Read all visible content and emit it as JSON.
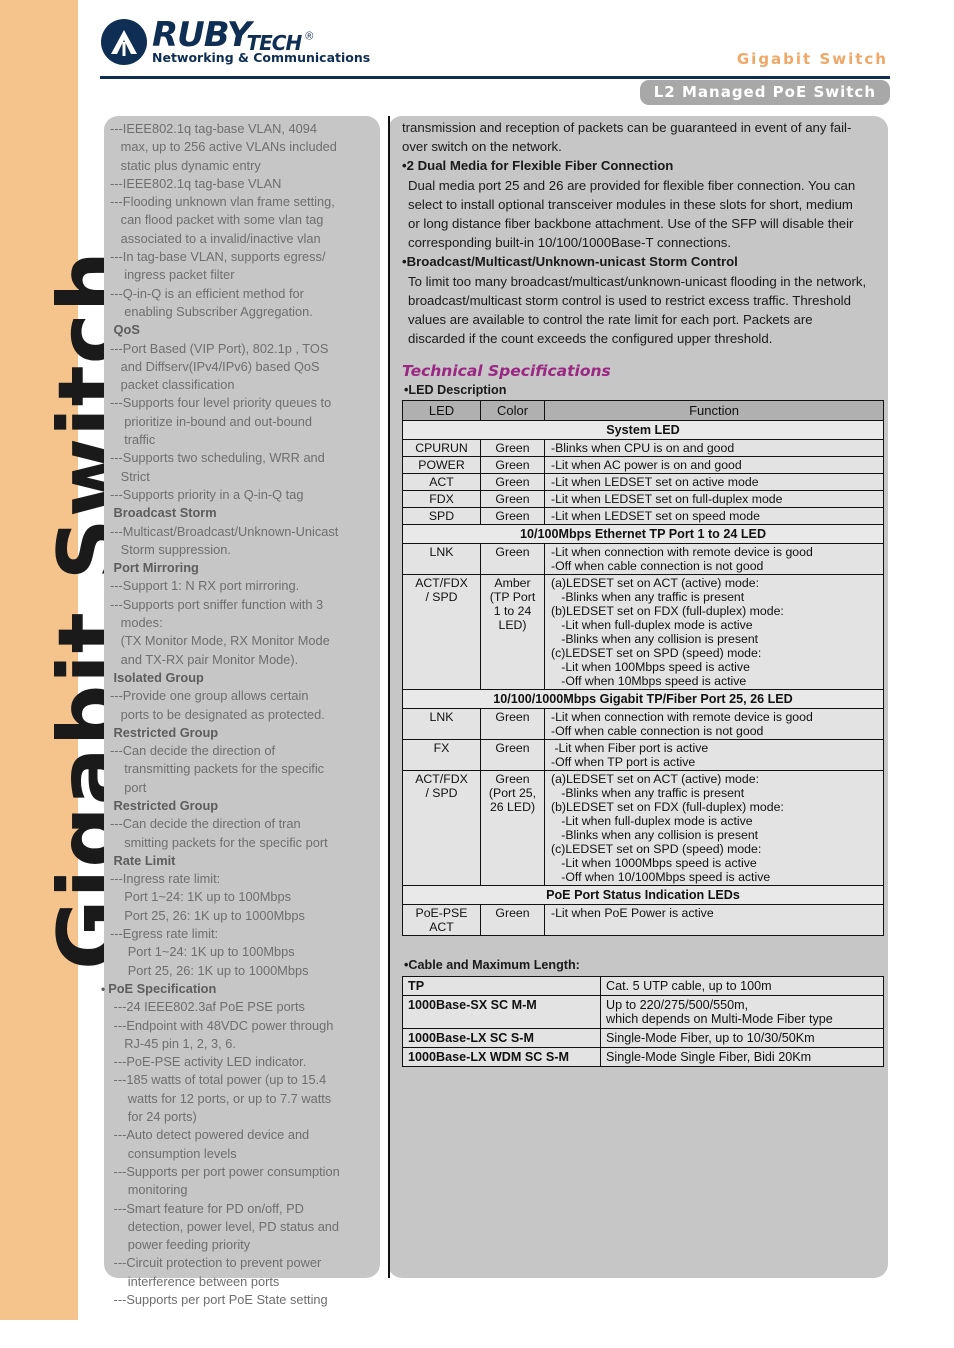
{
  "sidebar": {
    "vertical_text": "Gigabit Switch"
  },
  "header": {
    "logo_main": "RUBY",
    "logo_tech": "TECH",
    "logo_reg": "®",
    "logo_sub": "Networking & Communications",
    "product_line": "Gigabit Switch",
    "product_badge": "L2 Managed PoE Switch",
    "accent_orange": "#f0a868",
    "accent_navy": "#0e2e53",
    "accent_purple": "#9b2683",
    "badge_gray": "#a8a8a8"
  },
  "left_column": {
    "lines": [
      {
        "type": "item",
        "text": "---IEEE802.1q tag-base VLAN, 4094"
      },
      {
        "type": "cont",
        "text": "   max, up to 256 active VLANs included"
      },
      {
        "type": "cont",
        "text": "   static plus dynamic entry"
      },
      {
        "type": "item",
        "text": "---IEEE802.1q tag-base VLAN"
      },
      {
        "type": "item",
        "text": "---Flooding unknown vlan frame setting,"
      },
      {
        "type": "cont",
        "text": "   can flood packet with some vlan tag"
      },
      {
        "type": "cont",
        "text": "   associated to a invalid/inactive vlan"
      },
      {
        "type": "item",
        "text": "---In tag-base VLAN, supports egress/"
      },
      {
        "type": "cont",
        "text": "    ingress packet filter"
      },
      {
        "type": "item",
        "text": "---Q-in-Q is an efficient method for"
      },
      {
        "type": "cont",
        "text": "    enabling Subscriber Aggregation."
      },
      {
        "type": "head",
        "text": " QoS"
      },
      {
        "type": "item",
        "text": "---Port Based (VIP Port), 802.1p , TOS"
      },
      {
        "type": "cont",
        "text": "   and Diffserv(IPv4/IPv6) based QoS"
      },
      {
        "type": "cont",
        "text": "   packet classification"
      },
      {
        "type": "item",
        "text": "---Supports four level priority queues to"
      },
      {
        "type": "cont",
        "text": "    prioritize in-bound and out-bound"
      },
      {
        "type": "cont",
        "text": "    traffic"
      },
      {
        "type": "item",
        "text": "---Supports two scheduling, WRR and"
      },
      {
        "type": "cont",
        "text": "   Strict"
      },
      {
        "type": "item",
        "text": "---Supports priority in a Q-in-Q tag"
      },
      {
        "type": "head",
        "text": " Broadcast Storm"
      },
      {
        "type": "item",
        "text": "---Multicast/Broadcast/Unknown-Unicast"
      },
      {
        "type": "cont",
        "text": "   Storm suppression."
      },
      {
        "type": "head",
        "text": " Port Mirroring"
      },
      {
        "type": "item",
        "text": "---Support 1: N RX port mirroring."
      },
      {
        "type": "item",
        "text": "---Supports port sniffer function with 3"
      },
      {
        "type": "cont",
        "text": "   modes:"
      },
      {
        "type": "cont",
        "text": "   (TX Monitor Mode, RX Monitor Mode"
      },
      {
        "type": "cont",
        "text": "   and TX-RX pair Monitor Mode)."
      },
      {
        "type": "head",
        "text": " Isolated Group"
      },
      {
        "type": "item",
        "text": "---Provide one group allows certain"
      },
      {
        "type": "cont",
        "text": "   ports to be designated as protected."
      },
      {
        "type": "head",
        "text": " Restricted Group"
      },
      {
        "type": "item",
        "text": "---Can decide the direction of"
      },
      {
        "type": "cont",
        "text": "    transmitting packets for the specific"
      },
      {
        "type": "cont",
        "text": "    port"
      },
      {
        "type": "head",
        "text": " Restricted Group"
      },
      {
        "type": "item",
        "text": "---Can decide the direction of tran"
      },
      {
        "type": "cont",
        "text": "    smitting packets for the specific port"
      },
      {
        "type": "head",
        "text": " Rate Limit"
      },
      {
        "type": "item",
        "text": "---Ingress rate limit:"
      },
      {
        "type": "cont",
        "text": "    Port 1~24: 1K up to 100Mbps"
      },
      {
        "type": "cont",
        "text": "    Port 25, 26: 1K up to 1000Mbps"
      },
      {
        "type": "item",
        "text": "---Egress rate limit:"
      },
      {
        "type": "cont",
        "text": "     Port 1~24: 1K up to 100Mbps"
      },
      {
        "type": "cont",
        "text": "     Port 25, 26: 1K up to 1000Mbps"
      },
      {
        "type": "bullet",
        "text": "PoE Specification"
      },
      {
        "type": "item",
        "text": " ---24 IEEE802.3af PoE PSE ports"
      },
      {
        "type": "item",
        "text": " ---Endpoint with 48VDC power through"
      },
      {
        "type": "cont",
        "text": "    RJ-45 pin 1, 2, 3, 6."
      },
      {
        "type": "item",
        "text": " ---PoE-PSE activity LED indicator."
      },
      {
        "type": "item",
        "text": " ---185 watts of total power (up to 15.4"
      },
      {
        "type": "cont",
        "text": "     watts for 12 ports, or up to 7.7 watts"
      },
      {
        "type": "cont",
        "text": "     for 24 ports)"
      },
      {
        "type": "item",
        "text": " ---Auto detect powered device and"
      },
      {
        "type": "cont",
        "text": "     consumption levels"
      },
      {
        "type": "item",
        "text": " ---Supports per port power consumption"
      },
      {
        "type": "cont",
        "text": "     monitoring"
      },
      {
        "type": "item",
        "text": " ---Smart feature for PD on/off, PD"
      },
      {
        "type": "cont",
        "text": "     detection, power level, PD status and"
      },
      {
        "type": "cont",
        "text": "     power feeding priority"
      },
      {
        "type": "item",
        "text": " ---Circuit protection to prevent power"
      },
      {
        "type": "cont",
        "text": "     interference between ports"
      },
      {
        "type": "item",
        "text": " ---Supports per port PoE State setting"
      }
    ]
  },
  "right_column": {
    "intro_lines": [
      "transmission and reception of packets can be guaranteed in event of any fail-",
      "over switch on the network."
    ],
    "sections": [
      {
        "heading": "2 Dual Media for Flexible Fiber Connection",
        "body_lines": [
          "Dual media port 25 and 26 are provided for flexible fiber connection. You can",
          "select to install optional transceiver modules in these slots for short, medium",
          "or long distance fiber backbone attachment. Use of the SFP will disable their",
          "corresponding built-in 10/100/1000Base-T connections."
        ]
      },
      {
        "heading": "Broadcast/Multicast/Unknown-unicast Storm Control",
        "body_lines": [
          "To limit too many broadcast/multicast/unknown-unicast flooding in the network,",
          "broadcast/multicast storm control is used to restrict excess traffic. Threshold",
          "values are available to control the rate limit for each port. Packets are",
          "discarded if the count exceeds the configured upper threshold."
        ]
      }
    ],
    "tech_spec_title": "Technical Specifications",
    "led_description_label": "LED Description",
    "led_table": {
      "headers": [
        "LED",
        "Color",
        "Function"
      ],
      "rows": [
        {
          "kind": "section",
          "title": "System LED"
        },
        {
          "kind": "data",
          "led": "CPURUN",
          "color": "Green",
          "function": [
            "-Blinks when CPU is on and good"
          ]
        },
        {
          "kind": "data",
          "led": "POWER",
          "color": "Green",
          "function": [
            "-Lit when AC power is on and good"
          ]
        },
        {
          "kind": "data",
          "led": "ACT",
          "color": "Green",
          "function": [
            "-Lit when LEDSET set on active mode"
          ]
        },
        {
          "kind": "data",
          "led": "FDX",
          "color": "Green",
          "function": [
            "-Lit when LEDSET set on full-duplex mode"
          ]
        },
        {
          "kind": "data",
          "led": "SPD",
          "color": "Green",
          "function": [
            "-Lit when LEDSET set on speed mode"
          ]
        },
        {
          "kind": "section",
          "title": "10/100Mbps Ethernet TP Port 1 to 24 LED"
        },
        {
          "kind": "data",
          "led": "LNK",
          "color": "Green",
          "function": [
            "-Lit when connection with remote device is good",
            "-Off when cable connection is not good"
          ]
        },
        {
          "kind": "data",
          "led": "ACT/FDX\n/ SPD",
          "color": "Amber\n(TP Port\n1 to 24\nLED)",
          "function": [
            "(a)LEDSET set on ACT (active) mode:",
            "   -Blinks when any traffic is present",
            "(b)LEDSET set on FDX (full-duplex) mode:",
            "   -Lit when full-duplex mode is active",
            "   -Blinks when any collision is present",
            "(c)LEDSET set on SPD (speed) mode:",
            "   -Lit when 100Mbps speed is active",
            "   -Off when 10Mbps speed is active"
          ]
        },
        {
          "kind": "section",
          "title": "10/100/1000Mbps Gigabit TP/Fiber Port 25, 26 LED"
        },
        {
          "kind": "data",
          "led": "LNK",
          "color": "Green",
          "function": [
            "-Lit when connection with remote device is good",
            "-Off when cable connection is not good"
          ]
        },
        {
          "kind": "data",
          "led": "FX",
          "color": "Green",
          "function": [
            " -Lit when Fiber port is active",
            "-Off when TP port is active"
          ]
        },
        {
          "kind": "data",
          "led": "ACT/FDX\n/ SPD",
          "color": "Green\n(Port 25,\n26 LED)",
          "function": [
            "(a)LEDSET set on ACT (active) mode:",
            "   -Blinks when any traffic is present",
            "(b)LEDSET set on FDX (full-duplex) mode:",
            "   -Lit when full-duplex mode is active",
            "   -Blinks when any collision is present",
            "(c)LEDSET set on SPD (speed) mode:",
            "   -Lit when 1000Mbps speed is active",
            "   -Off when 10/100Mbps speed is active"
          ]
        },
        {
          "kind": "section",
          "title": "PoE Port Status Indication LEDs"
        },
        {
          "kind": "data",
          "led": "PoE-PSE\nACT",
          "color": "Green",
          "function": [
            "-Lit when PoE Power is active"
          ]
        }
      ]
    },
    "cable_label": "Cable and Maximum Length:",
    "cable_table": {
      "rows": [
        {
          "key": "TP",
          "value": [
            "Cat. 5 UTP cable, up to 100m"
          ]
        },
        {
          "key": "1000Base-SX SC M-M",
          "value": [
            " Up to 220/275/500/550m,",
            "which depends on Multi-Mode Fiber type"
          ]
        },
        {
          "key": "1000Base-LX SC S-M",
          "value": [
            "Single-Mode Fiber, up to 10/30/50Km"
          ]
        },
        {
          "key": "1000Base-LX WDM SC S-M",
          "value": [
            "Single-Mode Single Fiber, Bidi 20Km"
          ]
        }
      ]
    }
  }
}
